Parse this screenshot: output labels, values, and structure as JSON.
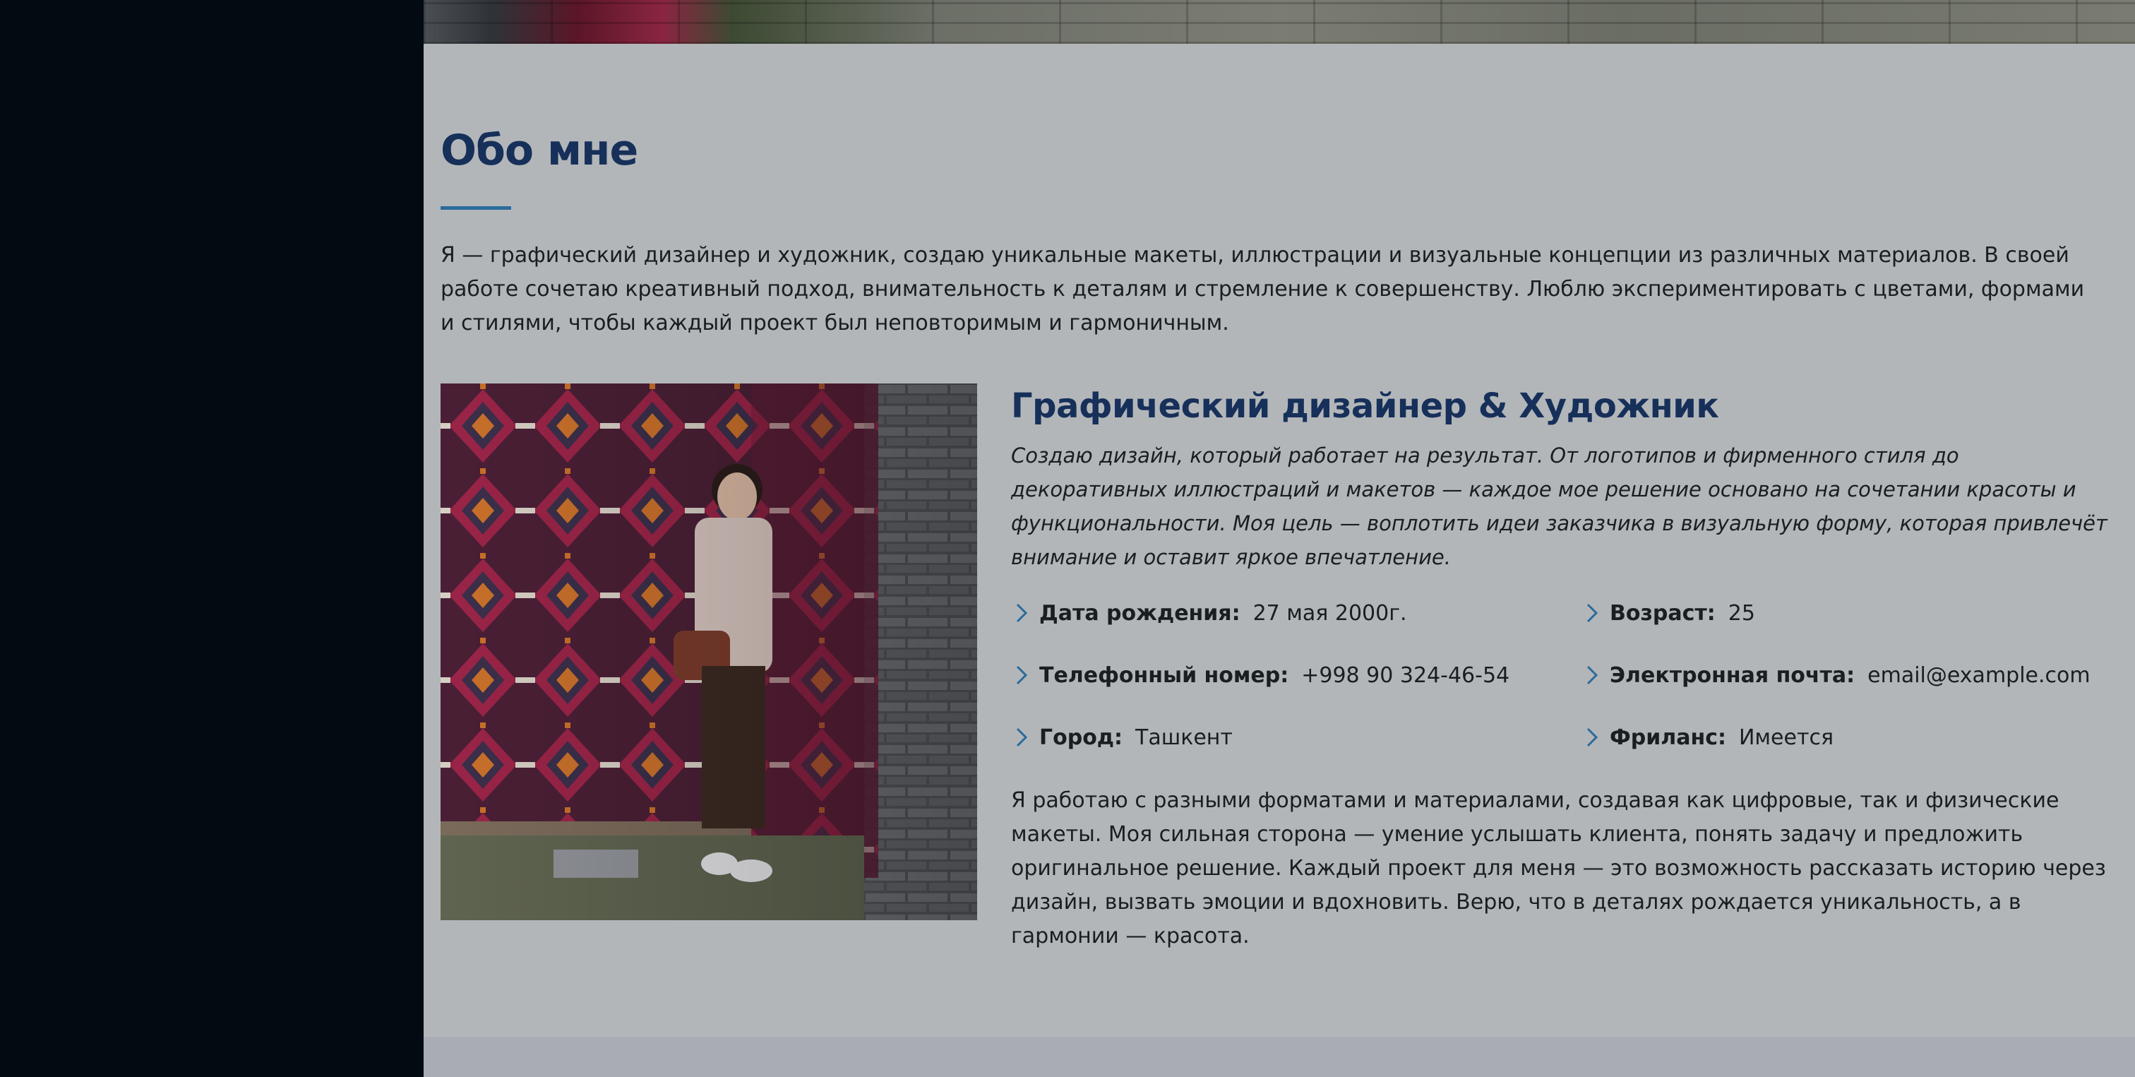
{
  "about": {
    "title": "Обо мне",
    "intro": "Я — графический дизайнер и художник, создаю уникальные макеты, иллюстрации и визуальные концепции из различных материалов. В своей работе сочетаю креативный подход, внимательность к деталям и стремление к совершенству. Люблю экспериментировать с цветами, формами и стилями, чтобы каждый проект был неповторимым и гармоничным.",
    "role_title": "Графический дизайнер & Художник",
    "role_description": "Создаю дизайн, который работает на результат. От логотипов и фирменного стиля до декоративных иллюстраций и макетов — каждое мое решение основано на сочетании красоты и функциональности. Моя цель — воплотить идеи заказчика в визуальную форму, которая привлечёт внимание и оставит яркое впечатление.",
    "facts": [
      {
        "label": "Дата рождения:",
        "value": "27 мая 2000г."
      },
      {
        "label": "Возраст:",
        "value": "25"
      },
      {
        "label": "Телефонный номер:",
        "value": "+998 90 324-46-54"
      },
      {
        "label": "Электронная почта:",
        "value": "email@example.com"
      },
      {
        "label": "Город:",
        "value": "Ташкент"
      },
      {
        "label": "Фриланс:",
        "value": "Имеется"
      }
    ],
    "bio": "Я работаю с разными форматами и материалами, создавая как цифровые, так и физические макеты. Моя сильная сторона — умение услышать клиента, понять задачу и предложить оригинальное решение. Каждый проект для меня — это возможность рассказать историю через дизайн, вызвать эмоции и вдохновить. Верю, что в деталях рождается уникальность, а в гармонии — красота."
  },
  "icons": {
    "fact_marker": "chevron-right-icon",
    "photo": "portrait-photo"
  },
  "colors": {
    "sidebar": "#030a12",
    "background": "#b3b6b9",
    "heading": "#16305a",
    "accent": "#2a6b9c",
    "text": "#1a1d21"
  }
}
